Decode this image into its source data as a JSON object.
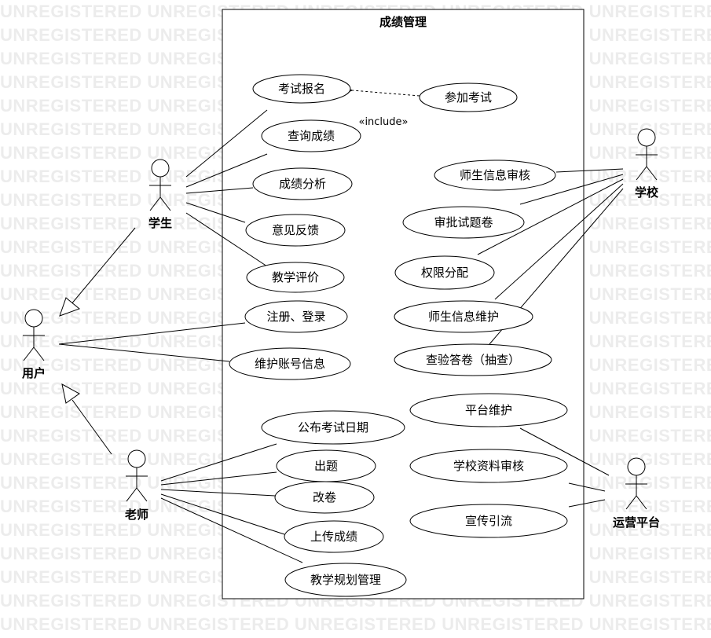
{
  "watermark_text": "UNREGISTERED",
  "system": {
    "title": "成绩管理"
  },
  "actors": {
    "student": "学生",
    "user": "用户",
    "teacher": "老师",
    "school": "学校",
    "platform": "运营平台"
  },
  "use_cases": {
    "exam_signup": "考试报名",
    "join_exam": "参加考试",
    "query_score": "查询成绩",
    "score_analysis": "成绩分析",
    "feedback": "意见反馈",
    "teaching_eval": "教学评价",
    "register_login": "注册、登录",
    "maintain_account": "维护账号信息",
    "publish_exam_date": "公布考试日期",
    "make_questions": "出题",
    "grade_papers": "改卷",
    "upload_scores": "上传成绩",
    "teaching_plan": "教学规划管理",
    "review_info": "师生信息审核",
    "approve_papers": "审批试题卷",
    "permissions": "权限分配",
    "maintain_info": "师生信息维护",
    "check_answers": "查验答卷（抽查）",
    "platform_maint": "平台维护",
    "school_review": "学校资料审核",
    "promotion": "宣传引流"
  },
  "relations": {
    "include_label": "«include»"
  }
}
